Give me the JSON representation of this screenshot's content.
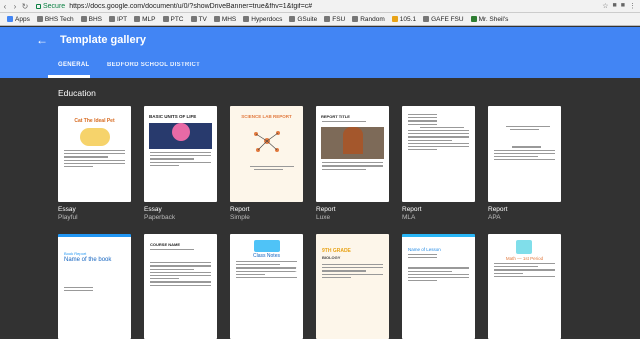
{
  "browser": {
    "secure_label": "Secure",
    "url": "https://docs.google.com/document/u/0/?showDriveBanner=true&fhv=1&tgif=c#",
    "bookmarks": [
      "Apps",
      "BHS Tech",
      "BHS",
      "IPT",
      "MLP",
      "PTC",
      "TV",
      "MHS",
      "Hyperdocs",
      "GSuite",
      "FSU",
      "Random",
      "105.1",
      "GAFE FSU",
      "Mr. Sheil's"
    ]
  },
  "header": {
    "title": "Template gallery",
    "tabs": [
      "GENERAL",
      "BEDFORD SCHOOL DISTRICT"
    ],
    "active_tab": "GENERAL"
  },
  "section": {
    "title": "Education"
  },
  "templates_row1": [
    {
      "name": "Essay",
      "style": "Playful",
      "doc_title": "Cat The Ideal Pet"
    },
    {
      "name": "Essay",
      "style": "Paperback",
      "doc_title": "BASIC UNITS OF LIFE"
    },
    {
      "name": "Report",
      "style": "Simple",
      "doc_title": "SCIENCE LAB REPORT"
    },
    {
      "name": "Report",
      "style": "Luxe",
      "doc_title": "REPORT TITLE"
    },
    {
      "name": "Report",
      "style": "MLA",
      "doc_title": ""
    },
    {
      "name": "Report",
      "style": "APA",
      "doc_title": ""
    }
  ],
  "templates_row2": [
    {
      "doc_title": "Name of the book",
      "kicker": "Book Report"
    },
    {
      "doc_title": "COURSE NAME"
    },
    {
      "doc_title": "Class Notes"
    },
    {
      "doc_title": "9TH GRADE",
      "sub": "BIOLOGY"
    },
    {
      "doc_title": "Name of Lesson"
    },
    {
      "doc_title": "Math — 1st Period"
    }
  ],
  "colors": {
    "header_blue": "#4285f4",
    "background": "#323232"
  }
}
